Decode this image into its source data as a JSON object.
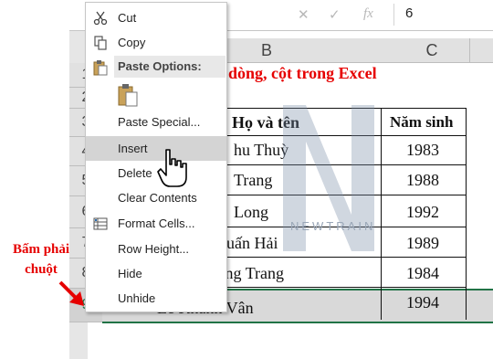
{
  "formula_bar": {
    "cancel_glyph": "✕",
    "enter_glyph": "✓",
    "fx_label": "fx",
    "value": "6"
  },
  "columns": [
    "B",
    "C"
  ],
  "rows": [
    "1",
    "2",
    "3",
    "4",
    "5",
    "6",
    "7",
    "8",
    "9"
  ],
  "sheet": {
    "title": "dòng, cột trong Excel",
    "header_name": "Họ và tên",
    "header_year": "Năm sinh",
    "names": [
      "hu Thuỳ",
      "Trang",
      "Long",
      "uấn Hải",
      "ơng Trang",
      "Lê Khánh Vân"
    ],
    "years": [
      "1983",
      "1988",
      "1992",
      "1989",
      "1984",
      "1994"
    ]
  },
  "watermark": {
    "text": "NEWTRAIN"
  },
  "annotation": {
    "line1": "Bấm phải",
    "line2": "chuột"
  },
  "context_menu": {
    "cut": "Cut",
    "copy": "Copy",
    "paste_options": "Paste Options:",
    "paste_special": "Paste Special...",
    "insert": "Insert",
    "delete": "Delete",
    "clear_contents": "Clear Contents",
    "format_cells": "Format Cells...",
    "row_height": "Row Height...",
    "hide": "Hide",
    "unhide": "Unhide"
  },
  "colors": {
    "accent": "#217346",
    "annotation": "#e60000",
    "hover": "#d4d4d4"
  }
}
